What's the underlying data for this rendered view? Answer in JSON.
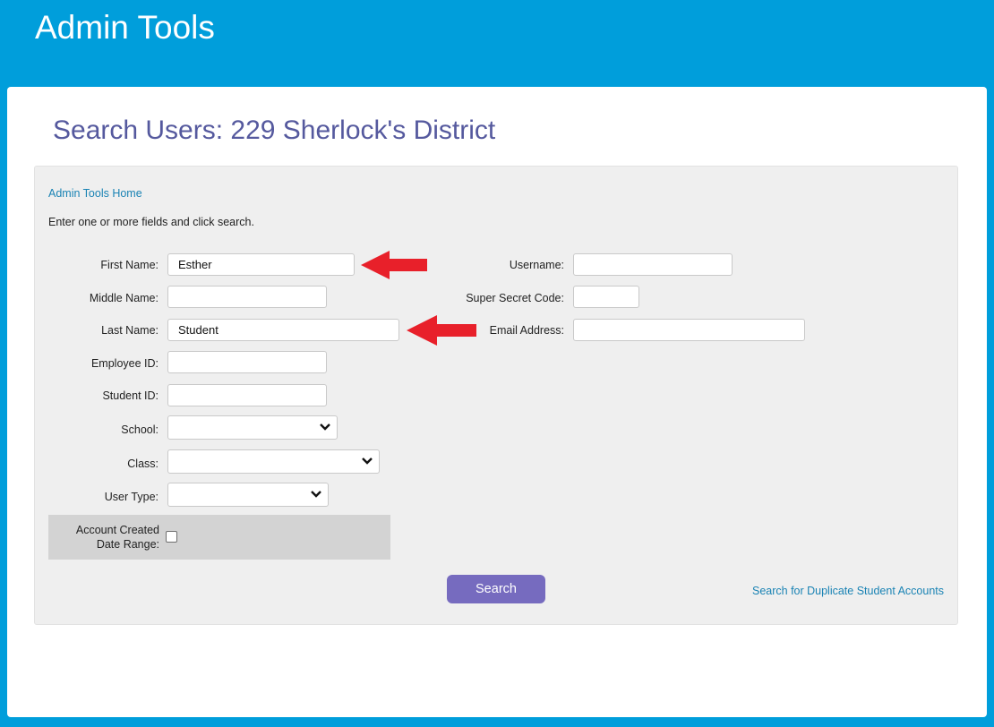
{
  "header": {
    "title": "Admin Tools"
  },
  "page": {
    "title": "Search Users: 229 Sherlock's District"
  },
  "panel": {
    "home_link": "Admin Tools Home",
    "instructions": "Enter one or more fields and click search."
  },
  "form": {
    "first_name": {
      "label": "First Name:",
      "value": "Esther"
    },
    "middle_name": {
      "label": "Middle Name:",
      "value": ""
    },
    "last_name": {
      "label": "Last Name:",
      "value": "Student"
    },
    "employee_id": {
      "label": "Employee ID:",
      "value": ""
    },
    "student_id": {
      "label": "Student ID:",
      "value": ""
    },
    "school": {
      "label": "School:",
      "value": ""
    },
    "class": {
      "label": "Class:",
      "value": ""
    },
    "user_type": {
      "label": "User Type:",
      "value": ""
    },
    "username": {
      "label": "Username:",
      "value": ""
    },
    "super_secret_code": {
      "label": "Super Secret Code:",
      "value": ""
    },
    "email_address": {
      "label": "Email Address:",
      "value": ""
    },
    "account_created": {
      "label_line1": "Account Created",
      "label_line2": "Date Range:",
      "checked": false
    }
  },
  "actions": {
    "search_label": "Search",
    "duplicate_link": "Search for Duplicate Student Accounts"
  },
  "colors": {
    "background": "#009edb",
    "title": "#55599e",
    "link": "#1a83b4",
    "button": "#766bbf",
    "arrow": "#e8202a"
  },
  "annotations": {
    "arrow_icon": "red-left-arrow"
  }
}
